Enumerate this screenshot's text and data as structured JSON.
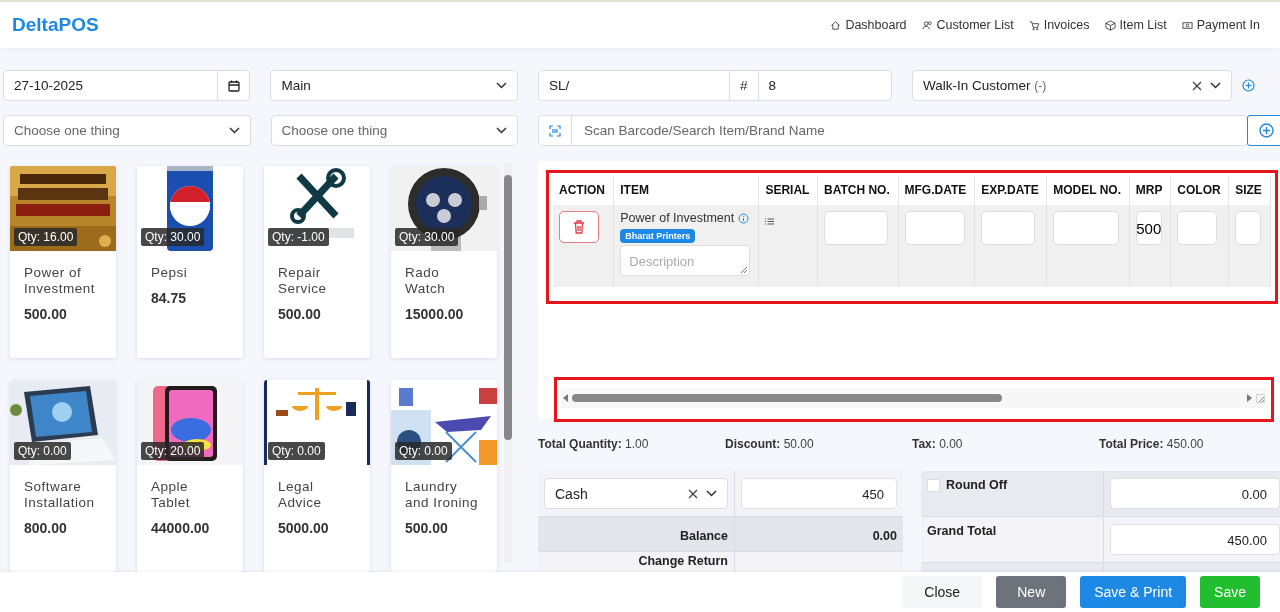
{
  "header": {
    "brand": "DeltaPOS",
    "nav": [
      {
        "label": "Dashboard"
      },
      {
        "label": "Customer List"
      },
      {
        "label": "Invoices"
      },
      {
        "label": "Item List"
      },
      {
        "label": "Payment In"
      }
    ]
  },
  "form": {
    "date": "27-10-2025",
    "warehouse": "Main",
    "prefix": "SL/",
    "hash": "#",
    "number": "8",
    "customer": "Walk-In Customer",
    "customer_suffix": "(-)",
    "category_placeholder": "Choose one thing",
    "brand_placeholder": "Choose one thing",
    "search_placeholder": "Scan Barcode/Search Item/Brand Name"
  },
  "products": [
    {
      "name": "Power of Investment",
      "price": "500.00",
      "qty": "Qty: 16.00"
    },
    {
      "name": "Pepsi",
      "price": "84.75",
      "qty": "Qty: 30.00"
    },
    {
      "name": "Repair Service",
      "price": "500.00",
      "qty": "Qty: -1.00"
    },
    {
      "name": "Rado Watch",
      "price": "15000.00",
      "qty": "Qty: 30.00"
    },
    {
      "name": "Software Installation",
      "price": "800.00",
      "qty": "Qty: 0.00"
    },
    {
      "name": "Apple Tablet",
      "price": "44000.00",
      "qty": "Qty: 20.00"
    },
    {
      "name": "Legal Advice",
      "price": "5000.00",
      "qty": "Qty: 0.00"
    },
    {
      "name": "Laundry and Ironing",
      "price": "500.00",
      "qty": "Qty: 0.00"
    }
  ],
  "table": {
    "columns": [
      "ACTION",
      "ITEM",
      "SERIAL",
      "BATCH NO.",
      "MFG.DATE",
      "EXP.DATE",
      "MODEL NO.",
      "MRP",
      "COLOR",
      "SIZE"
    ],
    "rows": [
      {
        "item": "Power of Investment",
        "tag": "Bharat Printers",
        "description_placeholder": "Description",
        "mrp": "500"
      }
    ]
  },
  "totals": [
    {
      "label": "Total Quantity:",
      "value": "1.00"
    },
    {
      "label": "Discount:",
      "value": "50.00"
    },
    {
      "label": "Tax:",
      "value": "0.00"
    },
    {
      "label": "Total Price:",
      "value": "450.00"
    }
  ],
  "payment": {
    "method": "Cash",
    "amount": "450",
    "balance_label": "Balance",
    "balance": "0.00",
    "change_label": "Change Return"
  },
  "summary": {
    "round_off_label": "Round Off",
    "round_off_checked": false,
    "round_value": "0.00",
    "grand_label": "Grand Total",
    "grand_value": "450.00"
  },
  "buttons": [
    {
      "label": "Close",
      "kind": "light"
    },
    {
      "label": "New",
      "kind": "secondary"
    },
    {
      "label": "Save & Print",
      "kind": "primary"
    },
    {
      "label": "Save",
      "kind": "success"
    }
  ]
}
